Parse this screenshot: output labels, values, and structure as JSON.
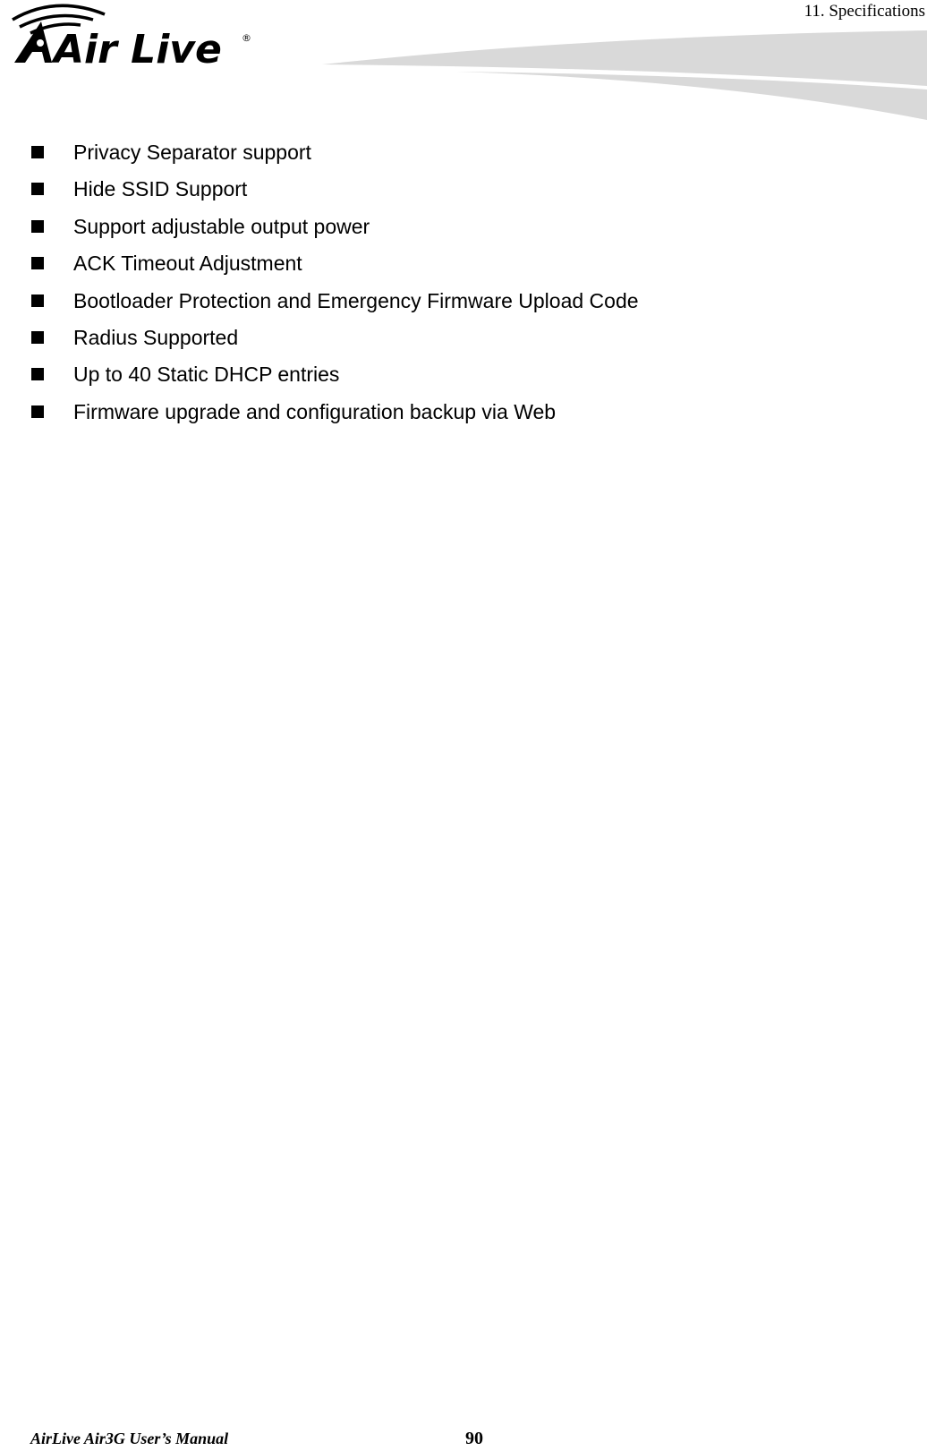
{
  "header": {
    "brand_name": "Air Live",
    "section_title": "11.  Specifications"
  },
  "features": [
    "Privacy Separator support",
    "Hide SSID Support",
    "Support adjustable output power",
    "ACK Timeout Adjustment",
    "Bootloader Protection and Emergency Firmware Upload Code",
    "Radius Supported",
    "Up to 40 Static DHCP entries",
    "Firmware upgrade and configuration backup via Web"
  ],
  "footer": {
    "manual_title": "AirLive Air3G User’s Manual",
    "page_number": "90"
  },
  "colors": {
    "swoosh": "#d9d9d9",
    "text": "#000000"
  }
}
